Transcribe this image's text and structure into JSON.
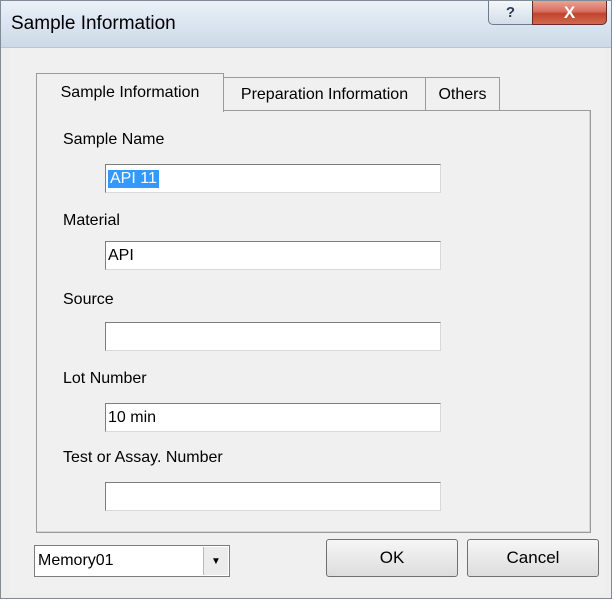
{
  "window": {
    "title": "Sample Information",
    "help_label": "?",
    "close_label": "X"
  },
  "tabs": [
    {
      "label": "Sample Information",
      "active": true
    },
    {
      "label": "Preparation Information",
      "active": false
    },
    {
      "label": "Others",
      "active": false
    }
  ],
  "fields": {
    "sample_name": {
      "label": "Sample Name",
      "value": "API 11",
      "selected": true
    },
    "material": {
      "label": "Material",
      "value": "API"
    },
    "source": {
      "label": "Source",
      "value": ""
    },
    "lot_number": {
      "label": "Lot Number",
      "value": "10 min"
    },
    "test_assay_number": {
      "label": "Test or Assay. Number",
      "value": ""
    }
  },
  "memory_select": {
    "value": "Memory01",
    "arrow_icon": "chevron-down-icon"
  },
  "buttons": {
    "ok_label": "OK",
    "cancel_label": "Cancel"
  },
  "colors": {
    "selection": "#3399ff",
    "close_button": "#c2432d"
  }
}
